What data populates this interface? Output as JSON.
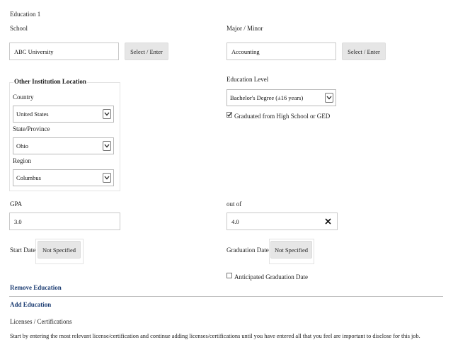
{
  "section": {
    "title": "Education 1"
  },
  "school": {
    "label": "School",
    "value": "ABC University",
    "button": "Select / Enter"
  },
  "major": {
    "label": "Major / Minor",
    "value": "Accounting",
    "button": "Select / Enter"
  },
  "location": {
    "title": "Other Institution Location",
    "country_label": "Country",
    "country_value": "United States",
    "state_label": "State/Province",
    "state_value": "Ohio",
    "region_label": "Region",
    "region_value": "Columbus"
  },
  "education_level": {
    "label": "Education Level",
    "value": "Bachelor's Degree (±16 years)",
    "graduated_label": "Graduated from High School or GED",
    "graduated_checked": true
  },
  "gpa": {
    "label": "GPA",
    "value": "3.0",
    "out_of_label": "out of",
    "out_of_value": "4.0"
  },
  "start_date": {
    "label": "Start Date",
    "button": "Not Specified"
  },
  "graduation_date": {
    "label": "Graduation Date",
    "button": "Not Specified",
    "anticipated_label": "Anticipated Graduation Date"
  },
  "actions": {
    "remove": "Remove Education",
    "add": "Add Education"
  },
  "licenses": {
    "title": "Licenses / Certifications",
    "description": "Start by entering the most relevant license/certification and continue adding licenses/certifications until you have entered all that you feel are important to disclose for this job."
  },
  "icons": {
    "chevron": "chevron-down-icon",
    "clear": "close-icon",
    "check": "checkmark-icon"
  },
  "colors": {
    "link": "#1f3f74",
    "button_bg": "#e6e6e6"
  }
}
